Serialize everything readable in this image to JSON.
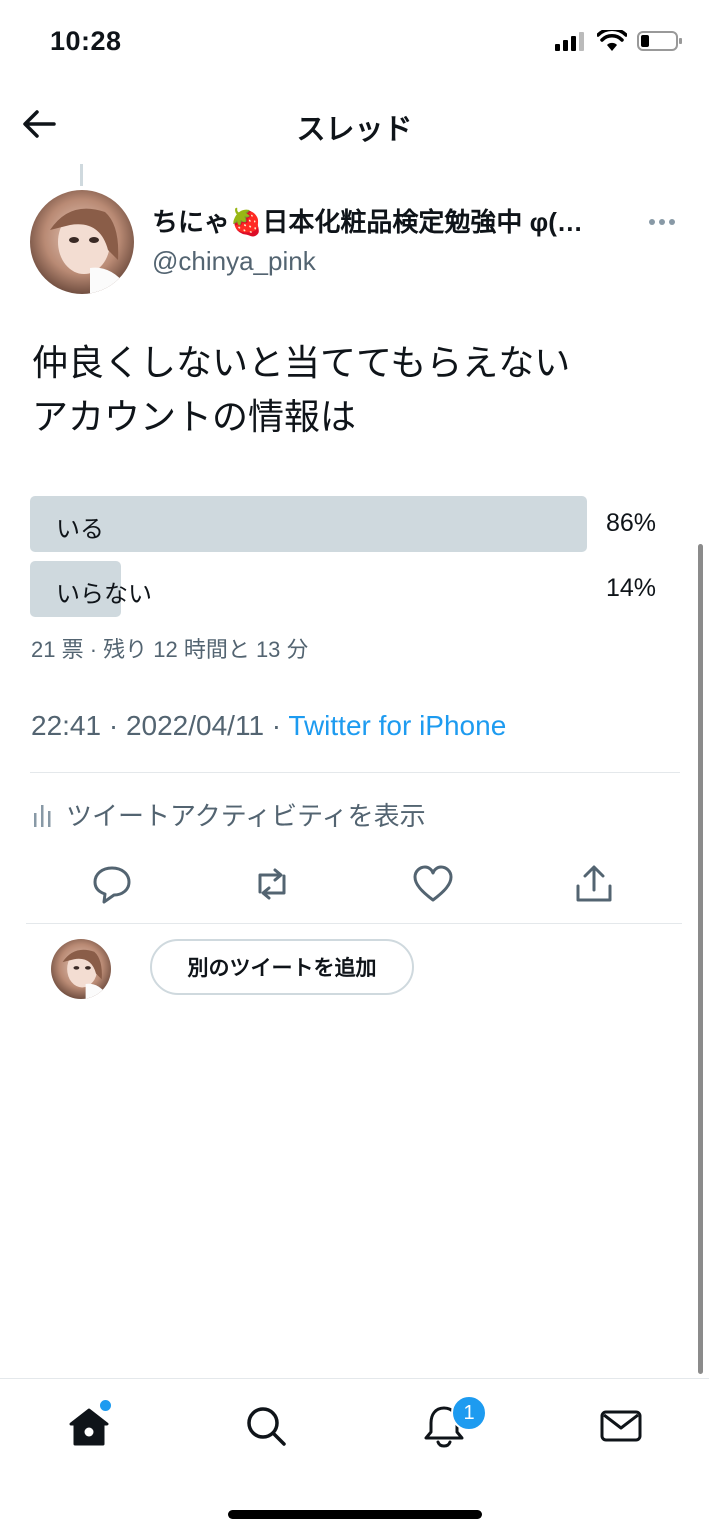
{
  "status_bar": {
    "time": "10:28"
  },
  "header": {
    "title": "スレッド"
  },
  "tweet": {
    "display_name": "ちにゃ🍓日本化粧品検定勉強中 φ(…",
    "handle": "@chinya_pink",
    "text_line1": "仲良くしないと当ててもらえない",
    "text_line2": "アカウントの情報は",
    "poll": {
      "options": [
        {
          "label": "いる",
          "percent_text": "86%",
          "percent": 86
        },
        {
          "label": "いらない",
          "percent_text": "14%",
          "percent": 14
        }
      ],
      "meta": "21 票 · 残り 12 時間と 13 分"
    },
    "timestamp": "22:41 · 2022/04/11 · ",
    "source": "Twitter for iPhone",
    "activity_label": "ツイートアクティビティを表示"
  },
  "composer": {
    "add_tweet_label": "別のツイートを追加"
  },
  "tabbar": {
    "notification_count": "1"
  },
  "colors": {
    "accent": "#1d9bf0",
    "poll_fill": "#cfd9de",
    "secondary_text": "#536471"
  },
  "icons": [
    "back-arrow-icon",
    "more-icon",
    "reply-icon",
    "retweet-icon",
    "like-icon",
    "share-icon",
    "home-icon",
    "search-icon",
    "notifications-icon",
    "messages-icon",
    "signal-icon",
    "wifi-icon",
    "battery-icon"
  ]
}
